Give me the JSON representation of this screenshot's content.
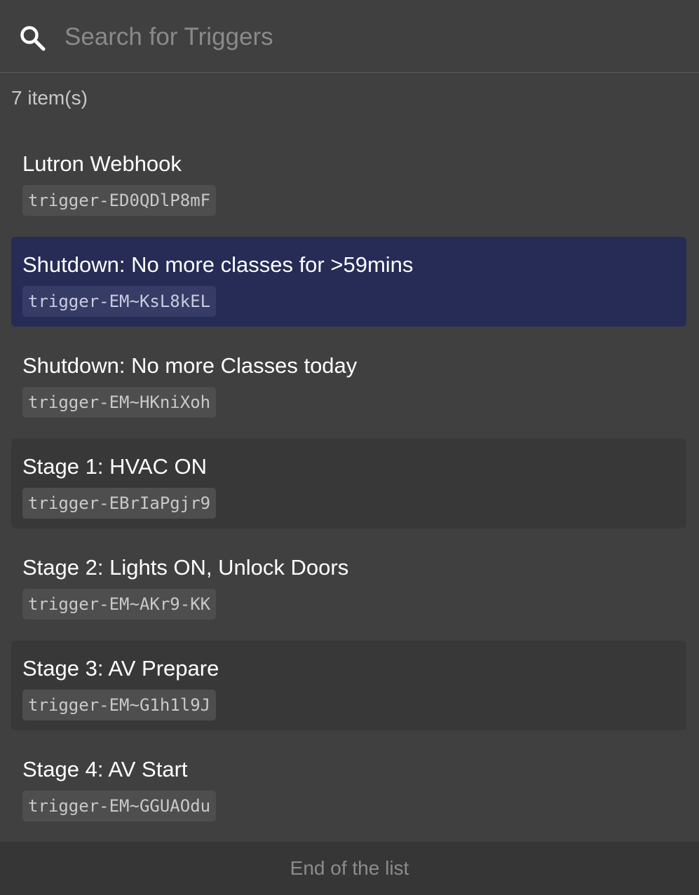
{
  "search": {
    "placeholder": "Search for Triggers",
    "value": "",
    "icon": "search-icon"
  },
  "list": {
    "count_text": "7 item(s)",
    "items": [
      {
        "title": "Lutron Webhook",
        "id": "trigger-ED0QDlP8mF",
        "state": "normal"
      },
      {
        "title": "Shutdown: No more classes for >59mins",
        "id": "trigger-EM~KsL8kEL",
        "state": "selected"
      },
      {
        "title": "Shutdown: No more Classes today",
        "id": "trigger-EM~HKniXoh",
        "state": "normal"
      },
      {
        "title": "Stage 1: HVAC ON",
        "id": "trigger-EBrIaPgjr9",
        "state": "alt"
      },
      {
        "title": "Stage 2: Lights ON, Unlock Doors",
        "id": "trigger-EM~AKr9-KK",
        "state": "normal"
      },
      {
        "title": "Stage 3: AV Prepare",
        "id": "trigger-EM~G1h1l9J",
        "state": "alt"
      },
      {
        "title": "Stage 4: AV Start",
        "id": "trigger-EM~GGUAOdu",
        "state": "normal"
      }
    ],
    "end_text": "End of the list"
  },
  "colors": {
    "background": "#404040",
    "selected": "#262c55",
    "alt_row": "#383838",
    "footer": "#363636"
  }
}
